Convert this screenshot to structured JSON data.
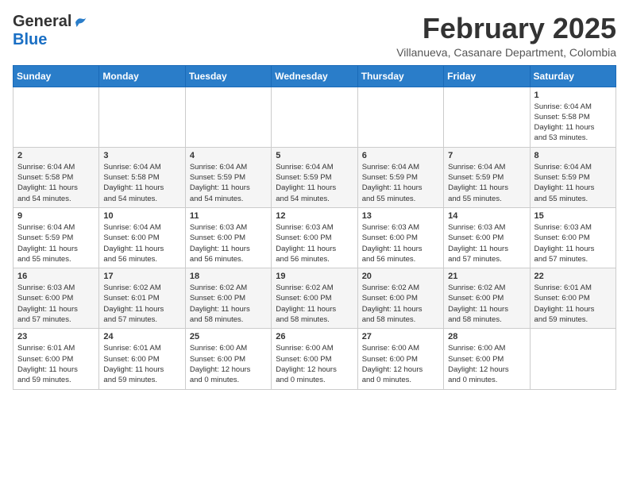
{
  "logo": {
    "general": "General",
    "blue": "Blue"
  },
  "header": {
    "month": "February 2025",
    "location": "Villanueva, Casanare Department, Colombia"
  },
  "days_of_week": [
    "Sunday",
    "Monday",
    "Tuesday",
    "Wednesday",
    "Thursday",
    "Friday",
    "Saturday"
  ],
  "weeks": [
    [
      {
        "day": "",
        "info": ""
      },
      {
        "day": "",
        "info": ""
      },
      {
        "day": "",
        "info": ""
      },
      {
        "day": "",
        "info": ""
      },
      {
        "day": "",
        "info": ""
      },
      {
        "day": "",
        "info": ""
      },
      {
        "day": "1",
        "info": "Sunrise: 6:04 AM\nSunset: 5:58 PM\nDaylight: 11 hours\nand 53 minutes."
      }
    ],
    [
      {
        "day": "2",
        "info": "Sunrise: 6:04 AM\nSunset: 5:58 PM\nDaylight: 11 hours\nand 54 minutes."
      },
      {
        "day": "3",
        "info": "Sunrise: 6:04 AM\nSunset: 5:58 PM\nDaylight: 11 hours\nand 54 minutes."
      },
      {
        "day": "4",
        "info": "Sunrise: 6:04 AM\nSunset: 5:59 PM\nDaylight: 11 hours\nand 54 minutes."
      },
      {
        "day": "5",
        "info": "Sunrise: 6:04 AM\nSunset: 5:59 PM\nDaylight: 11 hours\nand 54 minutes."
      },
      {
        "day": "6",
        "info": "Sunrise: 6:04 AM\nSunset: 5:59 PM\nDaylight: 11 hours\nand 55 minutes."
      },
      {
        "day": "7",
        "info": "Sunrise: 6:04 AM\nSunset: 5:59 PM\nDaylight: 11 hours\nand 55 minutes."
      },
      {
        "day": "8",
        "info": "Sunrise: 6:04 AM\nSunset: 5:59 PM\nDaylight: 11 hours\nand 55 minutes."
      }
    ],
    [
      {
        "day": "9",
        "info": "Sunrise: 6:04 AM\nSunset: 5:59 PM\nDaylight: 11 hours\nand 55 minutes."
      },
      {
        "day": "10",
        "info": "Sunrise: 6:04 AM\nSunset: 6:00 PM\nDaylight: 11 hours\nand 56 minutes."
      },
      {
        "day": "11",
        "info": "Sunrise: 6:03 AM\nSunset: 6:00 PM\nDaylight: 11 hours\nand 56 minutes."
      },
      {
        "day": "12",
        "info": "Sunrise: 6:03 AM\nSunset: 6:00 PM\nDaylight: 11 hours\nand 56 minutes."
      },
      {
        "day": "13",
        "info": "Sunrise: 6:03 AM\nSunset: 6:00 PM\nDaylight: 11 hours\nand 56 minutes."
      },
      {
        "day": "14",
        "info": "Sunrise: 6:03 AM\nSunset: 6:00 PM\nDaylight: 11 hours\nand 57 minutes."
      },
      {
        "day": "15",
        "info": "Sunrise: 6:03 AM\nSunset: 6:00 PM\nDaylight: 11 hours\nand 57 minutes."
      }
    ],
    [
      {
        "day": "16",
        "info": "Sunrise: 6:03 AM\nSunset: 6:00 PM\nDaylight: 11 hours\nand 57 minutes."
      },
      {
        "day": "17",
        "info": "Sunrise: 6:02 AM\nSunset: 6:01 PM\nDaylight: 11 hours\nand 57 minutes."
      },
      {
        "day": "18",
        "info": "Sunrise: 6:02 AM\nSunset: 6:00 PM\nDaylight: 11 hours\nand 58 minutes."
      },
      {
        "day": "19",
        "info": "Sunrise: 6:02 AM\nSunset: 6:00 PM\nDaylight: 11 hours\nand 58 minutes."
      },
      {
        "day": "20",
        "info": "Sunrise: 6:02 AM\nSunset: 6:00 PM\nDaylight: 11 hours\nand 58 minutes."
      },
      {
        "day": "21",
        "info": "Sunrise: 6:02 AM\nSunset: 6:00 PM\nDaylight: 11 hours\nand 58 minutes."
      },
      {
        "day": "22",
        "info": "Sunrise: 6:01 AM\nSunset: 6:00 PM\nDaylight: 11 hours\nand 59 minutes."
      }
    ],
    [
      {
        "day": "23",
        "info": "Sunrise: 6:01 AM\nSunset: 6:00 PM\nDaylight: 11 hours\nand 59 minutes."
      },
      {
        "day": "24",
        "info": "Sunrise: 6:01 AM\nSunset: 6:00 PM\nDaylight: 11 hours\nand 59 minutes."
      },
      {
        "day": "25",
        "info": "Sunrise: 6:00 AM\nSunset: 6:00 PM\nDaylight: 12 hours\nand 0 minutes."
      },
      {
        "day": "26",
        "info": "Sunrise: 6:00 AM\nSunset: 6:00 PM\nDaylight: 12 hours\nand 0 minutes."
      },
      {
        "day": "27",
        "info": "Sunrise: 6:00 AM\nSunset: 6:00 PM\nDaylight: 12 hours\nand 0 minutes."
      },
      {
        "day": "28",
        "info": "Sunrise: 6:00 AM\nSunset: 6:00 PM\nDaylight: 12 hours\nand 0 minutes."
      },
      {
        "day": "",
        "info": ""
      }
    ]
  ]
}
